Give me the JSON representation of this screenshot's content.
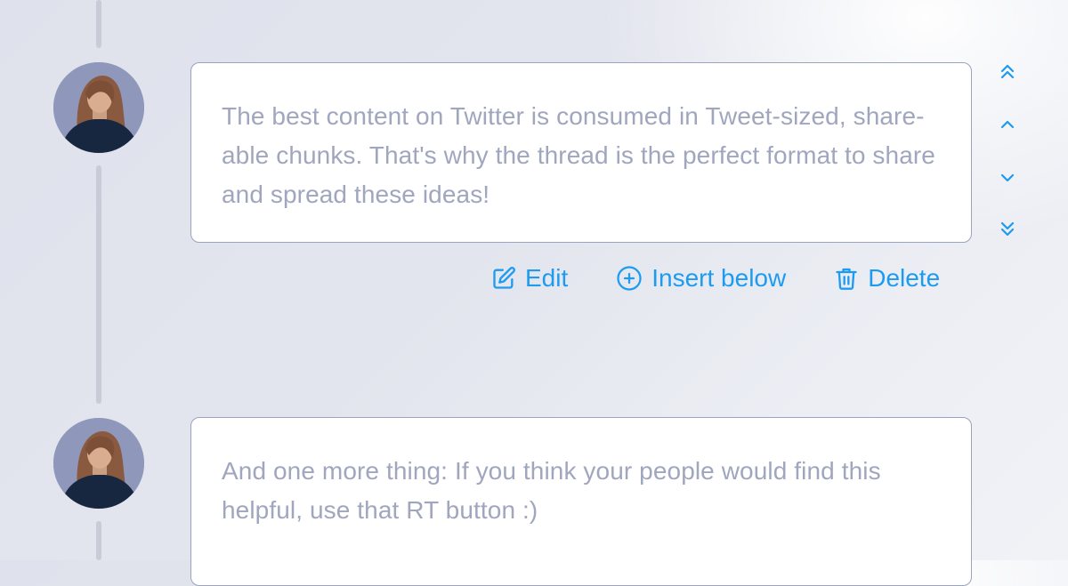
{
  "colors": {
    "accent": "#1d9bf0",
    "card_border": "#9aa3bf",
    "muted_text": "#a1a6bf",
    "timeline": "#c9ccd8"
  },
  "thread": {
    "tweets": [
      {
        "text": "The best content on Twitter is consumed in Tweet-sized, share-able chunks. That's why the thread is the perfect format to share and spread these ideas!"
      },
      {
        "text": "And one more thing: If you think your people would find this helpful, use that RT button :)"
      }
    ]
  },
  "actions": {
    "edit_label": "Edit",
    "insert_below_label": "Insert below",
    "delete_label": "Delete"
  },
  "icons": {
    "edit": "pencil-square-icon",
    "insert": "plus-circle-icon",
    "delete": "trash-icon",
    "move_top": "chevron-double-up-icon",
    "move_up": "chevron-up-icon",
    "move_down": "chevron-down-icon",
    "move_bottom": "chevron-double-down-icon"
  }
}
